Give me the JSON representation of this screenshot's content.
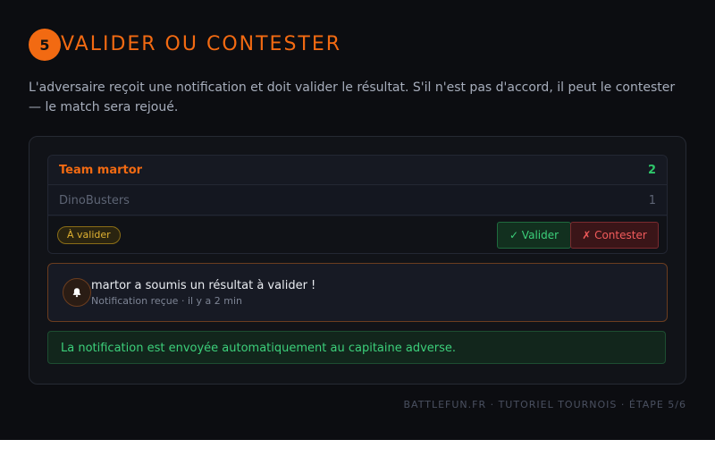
{
  "step": {
    "number": "5",
    "title": "VALIDER OU CONTESTER"
  },
  "intro": "L'adversaire reçoit une notification et doit valider le résultat. S'il n'est pas d'accord, il peut le contester — le match sera rejoué.",
  "match": {
    "teams": [
      {
        "name": "Team martor",
        "score": "2"
      },
      {
        "name": "DinoBusters",
        "score": "1"
      }
    ],
    "status": "À valider",
    "validate_label": "✓ Valider",
    "contest_label": "✗ Contester"
  },
  "notification": {
    "icon": "bell-icon",
    "title": "martor a soumis un résultat à valider !",
    "meta": "Notification reçue · il y a 2 min"
  },
  "info_note": "La notification est envoyée automatiquement au capitaine adverse.",
  "footer": "BATTLEFUN.FR · TUTORIEL TOURNOIS · ÉTAPE 5/6",
  "colors": {
    "accent": "#f26a12",
    "success": "#3ccf7a",
    "danger": "#f15b5b",
    "warning": "#e0b232",
    "background": "#0c0d11"
  }
}
